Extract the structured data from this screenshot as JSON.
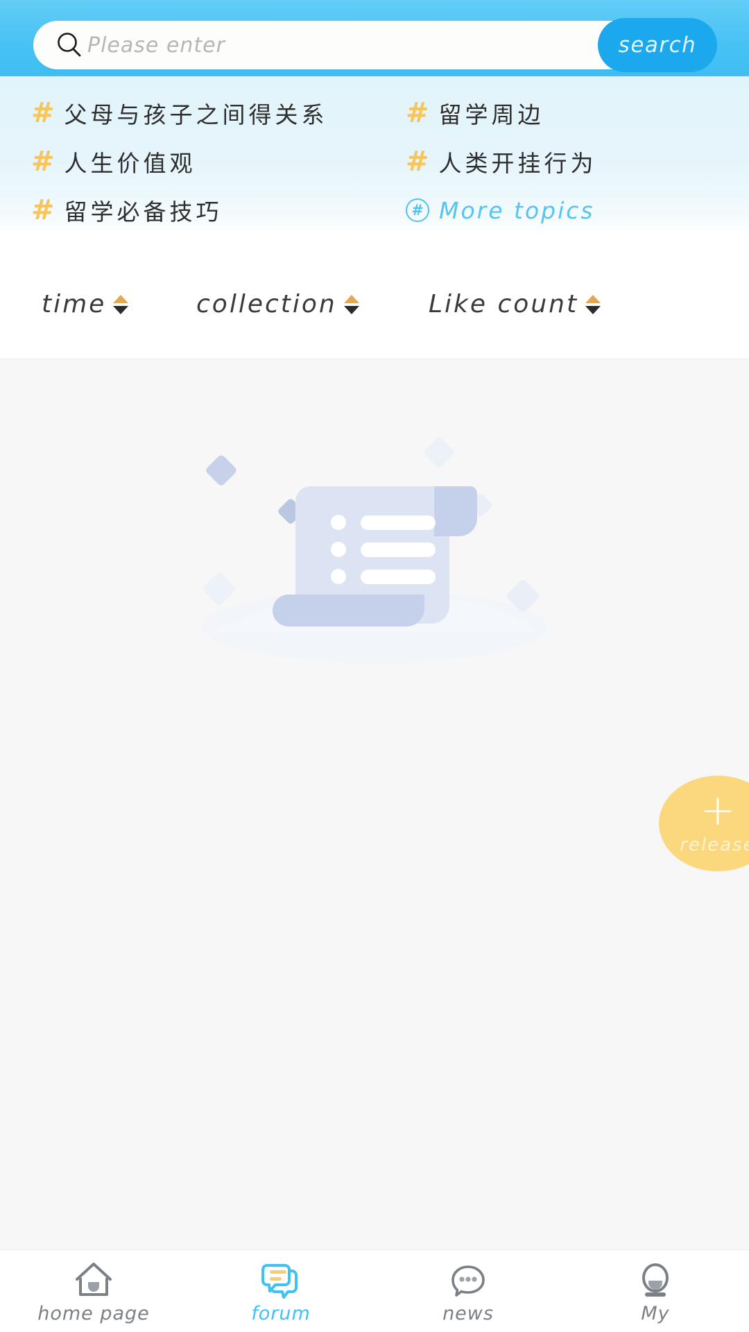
{
  "header": {
    "search": {
      "placeholder": "Please enter",
      "value": "",
      "button_label": "search",
      "icon": "search-icon"
    },
    "bg_color": "#47C2F5",
    "button_color": "#1BA8ED"
  },
  "topics": {
    "hash_symbol": "#",
    "hash_color": "#F8C55B",
    "items": [
      {
        "label": "父母与孩子之间得关系"
      },
      {
        "label": "留学周边"
      },
      {
        "label": "人生价值观"
      },
      {
        "label": "人类开挂行为"
      },
      {
        "label": "留学必备技巧"
      }
    ],
    "more": {
      "label": "More topics",
      "icon": "hash-circle-icon",
      "color": "#55C5F0"
    }
  },
  "sort_bar": {
    "items": [
      {
        "label": "time",
        "icon": "sort-arrows-icon"
      },
      {
        "label": "collection",
        "icon": "sort-arrows-icon"
      },
      {
        "label": "Like count",
        "icon": "sort-arrows-icon"
      }
    ],
    "arrow_up_color": "#E0A955",
    "arrow_down_color": "#2B2B2B"
  },
  "content": {
    "empty_state": {
      "icon": "empty-document-icon",
      "message": ""
    },
    "bg_color": "#F7F7F8"
  },
  "fab": {
    "label": "release",
    "icon": "plus-icon",
    "color": "#FBD87E"
  },
  "tabbar": {
    "items": [
      {
        "label": "home page",
        "icon": "home-icon",
        "active": false
      },
      {
        "label": "forum",
        "icon": "forum-chat-icon",
        "active": true
      },
      {
        "label": "news",
        "icon": "news-bubble-icon",
        "active": false
      },
      {
        "label": "My",
        "icon": "user-profile-icon",
        "active": false
      }
    ],
    "active_color": "#3EC1F3",
    "inactive_color": "#7B7F86"
  }
}
